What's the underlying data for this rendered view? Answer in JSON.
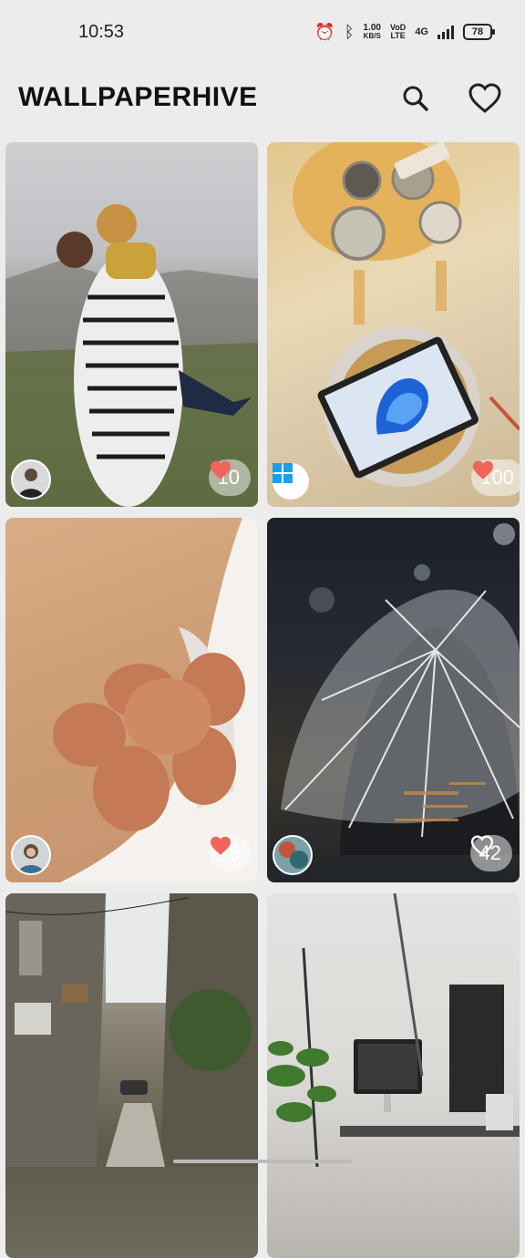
{
  "status_bar": {
    "time": "10:53",
    "icons": [
      "alarm-icon",
      "bluetooth-icon",
      "network-speed",
      "volte-icon",
      "signal-4g-icon",
      "signal-bars-icon",
      "battery-icon"
    ],
    "speed_value": "1.00",
    "speed_unit": "KB/S",
    "volte_top": "VoD",
    "volte_bottom": "LTE",
    "network": "4G",
    "battery": "78"
  },
  "app_bar": {
    "title": "WALLPAPERHIVE",
    "actions": [
      "search-icon",
      "heart-outline-icon"
    ]
  },
  "wallpapers": [
    {
      "subject": "couple embracing in mountains",
      "likes": "10",
      "liked": true
    },
    {
      "subject": "tablet on paint table",
      "likes": "100",
      "liked": true
    },
    {
      "subject": "brown eggs on cloth",
      "likes": "18",
      "liked": true
    },
    {
      "subject": "transparent umbrella at night",
      "likes": "42",
      "liked": false
    },
    {
      "subject": "narrow city street",
      "likes": "",
      "liked": false
    },
    {
      "subject": "desk with computer and plant",
      "likes": "",
      "liked": false
    }
  ],
  "colors": {
    "background": "#ececec",
    "like_red": "#f0645a",
    "title": "#111111"
  }
}
